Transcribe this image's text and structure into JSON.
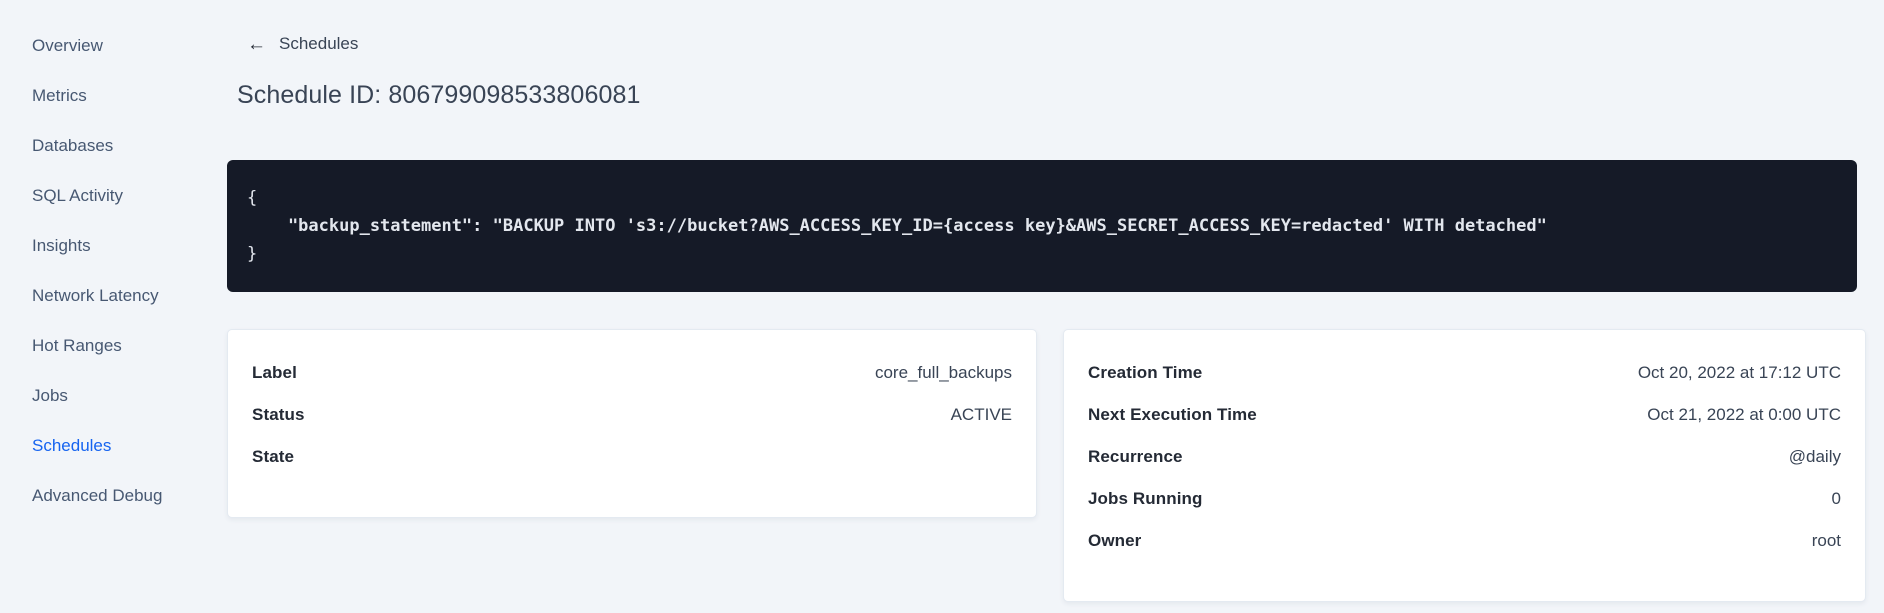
{
  "sidebar": {
    "items": [
      {
        "label": "Overview"
      },
      {
        "label": "Metrics"
      },
      {
        "label": "Databases"
      },
      {
        "label": "SQL Activity"
      },
      {
        "label": "Insights"
      },
      {
        "label": "Network Latency"
      },
      {
        "label": "Hot Ranges"
      },
      {
        "label": "Jobs"
      },
      {
        "label": "Schedules"
      },
      {
        "label": "Advanced Debug"
      }
    ],
    "active_item": "Schedules"
  },
  "header": {
    "back_icon": "←",
    "back_label": "Schedules",
    "title": "Schedule ID: 806799098533806081"
  },
  "code_block": {
    "background": "#151a27",
    "text_color": "#e3e7ee",
    "lines": [
      {
        "text": "{"
      },
      {
        "text": "    \"backup_statement\": \"BACKUP INTO 's3://bucket?AWS_ACCESS_KEY_ID={access key}&AWS_SECRET_ACCESS_KEY=redacted' WITH detached\""
      },
      {
        "text": "}"
      }
    ]
  },
  "cards": {
    "schedule": {
      "rows": [
        {
          "label": "Label",
          "value": "core_full_backups"
        },
        {
          "label": "Status",
          "value": "ACTIVE"
        },
        {
          "label": "State",
          "value": ""
        }
      ]
    },
    "details": {
      "rows": [
        {
          "label": "Creation Time",
          "value": "Oct 20, 2022 at 17:12 UTC"
        },
        {
          "label": "Next Execution Time",
          "value": "Oct 21, 2022 at 0:00 UTC"
        },
        {
          "label": "Recurrence",
          "value": "@daily"
        },
        {
          "label": "Jobs Running",
          "value": "0"
        },
        {
          "label": "Owner",
          "value": "root"
        }
      ]
    }
  },
  "colors": {
    "accent": "#1664f0",
    "page_bg": "#f2f5f9",
    "code_bg": "#151a27",
    "label_text": "#242a35",
    "body_text": "#394455",
    "nav_text": "#475872"
  }
}
